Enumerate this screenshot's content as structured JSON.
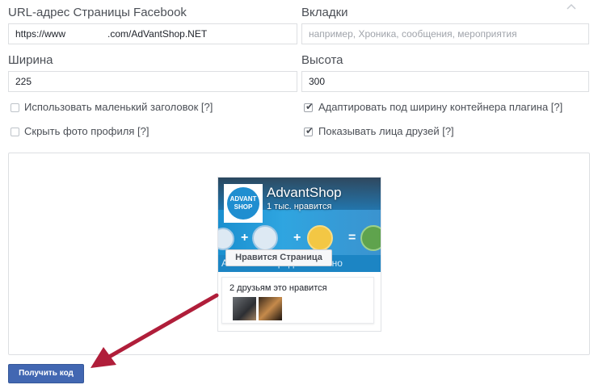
{
  "form": {
    "url_label": "URL-адрес Страницы Facebook",
    "url_value_prefix": "https://www",
    "url_value_suffix": ".com/AdVantShop.NET",
    "tabs_label": "Вкладки",
    "tabs_placeholder": "например, Хроника, сообщения, мероприятия",
    "width_label": "Ширина",
    "width_value": "225",
    "height_label": "Высота",
    "height_value": "300"
  },
  "options": [
    {
      "label": "Использовать маленький заголовок [?]",
      "checked": false
    },
    {
      "label": "Адаптировать под ширину контейнера плагина [?]",
      "checked": true
    },
    {
      "label": "Скрыть фото профиля [?]",
      "checked": false
    },
    {
      "label": "Показывать лица друзей [?]",
      "checked": true
    }
  ],
  "plugin": {
    "logo_text_1": "ADVANT",
    "logo_text_2": "SHOP",
    "page_name": "AdvantShop",
    "likes": "1 тыс. нравится",
    "like_button": "Нравится Страница",
    "cover_bottom_text": "ANTSHOP   Продавай по-но",
    "friends_text": "2 друзьям это нравится"
  },
  "actions": {
    "get_code": "Получить код"
  },
  "colors": {
    "button_blue": "#4267b2",
    "arrow_red": "#b01e3a"
  }
}
